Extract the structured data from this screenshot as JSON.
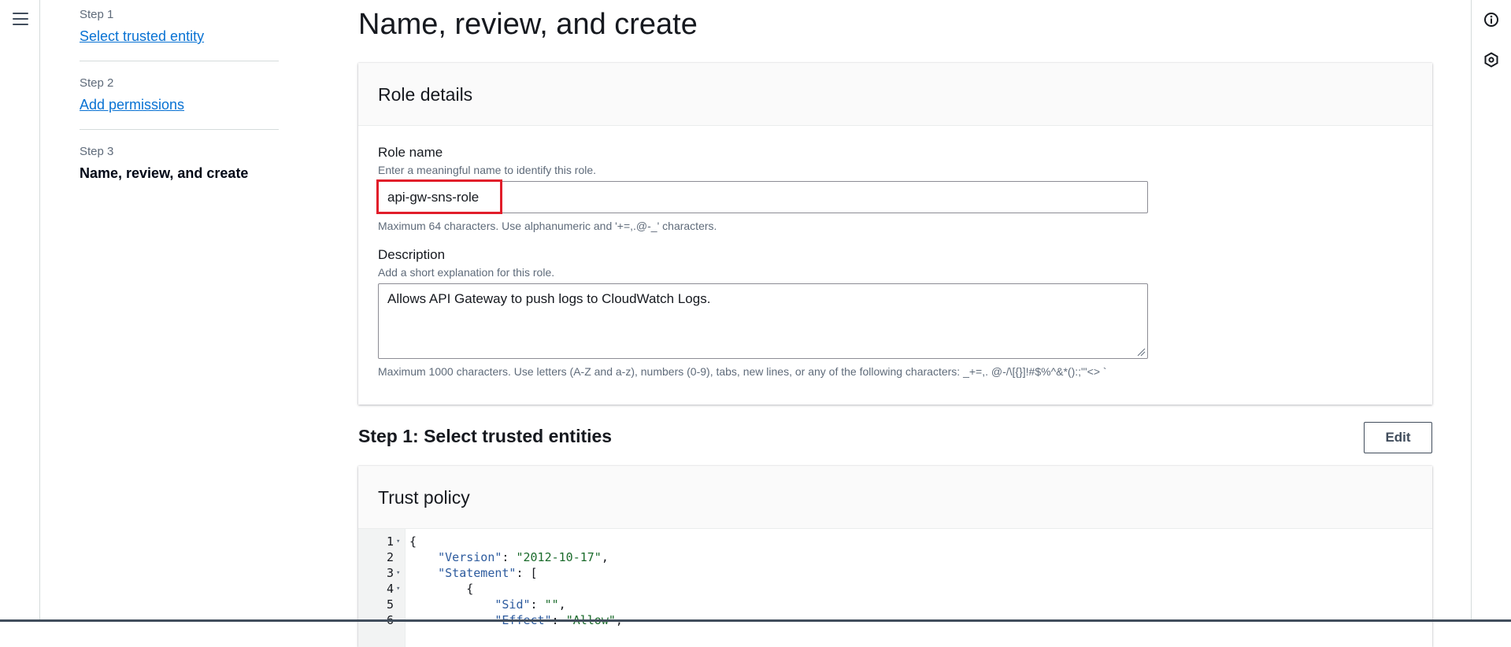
{
  "nav": {
    "menu_icon": "hamburger-menu-icon"
  },
  "steps": [
    {
      "label": "Step 1",
      "title": "Select trusted entity",
      "is_link": true
    },
    {
      "label": "Step 2",
      "title": "Add permissions",
      "is_link": true
    },
    {
      "label": "Step 3",
      "title": "Name, review, and create",
      "is_link": false
    }
  ],
  "page": {
    "title": "Name, review, and create"
  },
  "role_details": {
    "heading": "Role details",
    "role_name": {
      "label": "Role name",
      "description": "Enter a meaningful name to identify this role.",
      "value": "api-gw-sns-role",
      "constraint": "Maximum 64 characters. Use alphanumeric and '+=,.@-_' characters."
    },
    "description": {
      "label": "Description",
      "description": "Add a short explanation for this role.",
      "value": "Allows API Gateway to push logs to CloudWatch Logs.",
      "constraint": "Maximum 1000 characters. Use letters (A-Z and a-z), numbers (0-9), tabs, new lines, or any of the following characters: _+=,. @-/\\[{}]!#$%^&*():;\"'<> `"
    }
  },
  "step1_section": {
    "title": "Step 1: Select trusted entities",
    "edit_label": "Edit"
  },
  "trust_policy": {
    "heading": "Trust policy",
    "lines": [
      {
        "num": "1",
        "fold": true,
        "text": "{"
      },
      {
        "num": "2",
        "fold": false,
        "text": "    \"Version\": \"2012-10-17\","
      },
      {
        "num": "3",
        "fold": true,
        "text": "    \"Statement\": ["
      },
      {
        "num": "4",
        "fold": true,
        "text": "        {"
      },
      {
        "num": "5",
        "fold": false,
        "text": "            \"Sid\": \"\","
      },
      {
        "num": "6",
        "fold": false,
        "text": "            \"Effect\": \"Allow\","
      }
    ]
  },
  "right_rail": {
    "icons": [
      "info-icon",
      "feedback-icon"
    ]
  },
  "colors": {
    "link": "#0972d3",
    "highlight": "#e11d2a",
    "string": "#1a6b2b"
  }
}
